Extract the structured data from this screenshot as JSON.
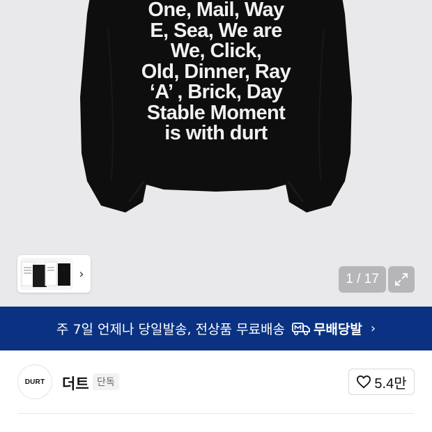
{
  "product": {
    "print_lines": [
      "One, Mail, Way",
      "E, Sea, We are",
      "We, Click,",
      "Old, Dinner, Ray",
      "‘A’ , Brick, Day",
      "Stable Moment",
      "is with durt"
    ]
  },
  "gallery": {
    "page_counter": "1 / 17",
    "thumb_chevron": "›"
  },
  "shipping_banner": {
    "text": "주 7일 언제나 당일발송, 전상품 무료배송",
    "badge_label": "무배당발",
    "chevron": "›"
  },
  "brand": {
    "logo_text": "DURT",
    "name": "더트",
    "tag": "단독",
    "likes": "5.4만"
  },
  "colors": {
    "banner_bg": "#0b3282",
    "image_bg": "#e9e9eb"
  }
}
